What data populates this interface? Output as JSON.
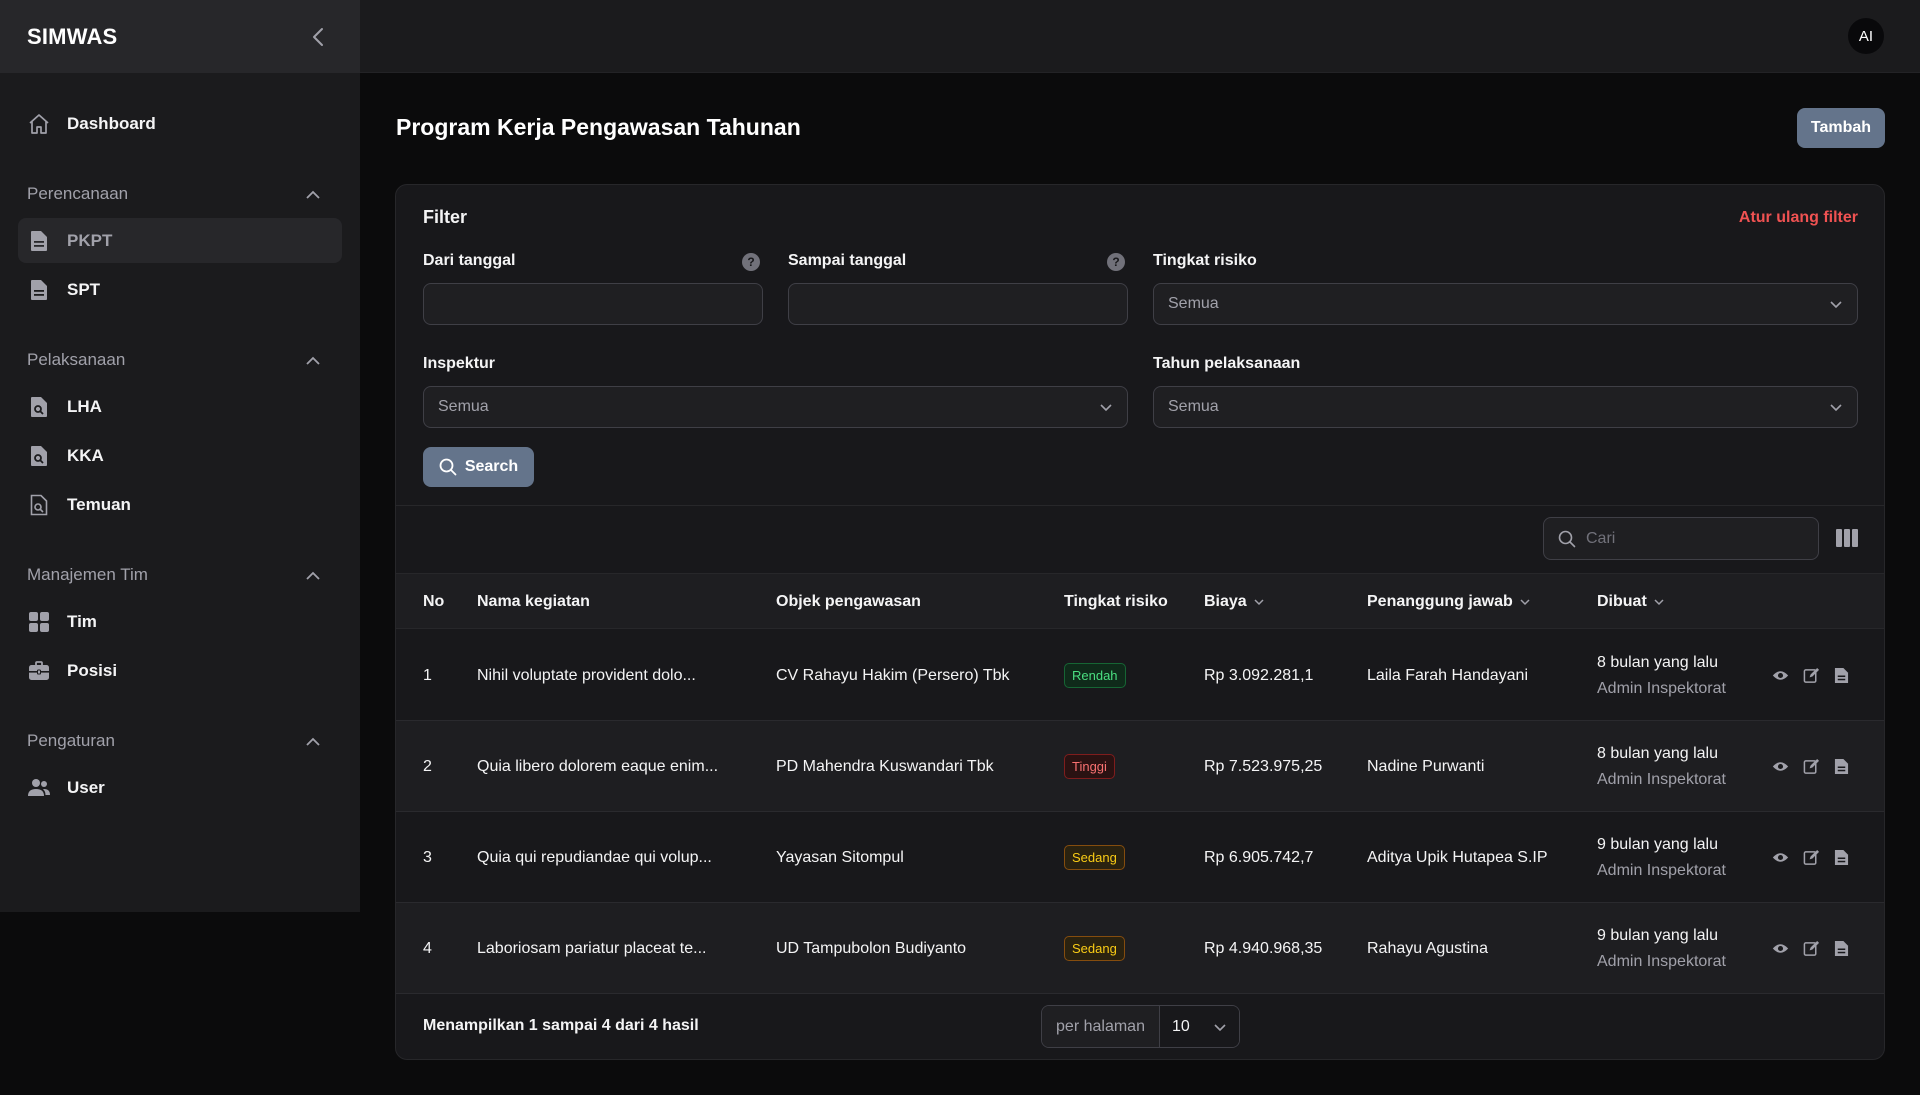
{
  "app": {
    "brand": "SIMWAS",
    "avatar_initials": "AI"
  },
  "sidebar": {
    "dashboard": "Dashboard",
    "groups": [
      {
        "title": "Perencanaan",
        "items": [
          {
            "label": "PKPT",
            "icon": "document-icon"
          },
          {
            "label": "SPT",
            "icon": "document-icon"
          }
        ]
      },
      {
        "title": "Pelaksanaan",
        "items": [
          {
            "label": "LHA",
            "icon": "document-search-icon"
          },
          {
            "label": "KKA",
            "icon": "document-search-icon"
          },
          {
            "label": "Temuan",
            "icon": "document-search-outline-icon"
          }
        ]
      },
      {
        "title": "Manajemen Tim",
        "items": [
          {
            "label": "Tim",
            "icon": "grid-icon"
          },
          {
            "label": "Posisi",
            "icon": "briefcase-icon"
          }
        ]
      },
      {
        "title": "Pengaturan",
        "items": [
          {
            "label": "User",
            "icon": "users-icon"
          }
        ]
      }
    ]
  },
  "page": {
    "title": "Program Kerja Pengawasan Tahunan",
    "add_label": "Tambah"
  },
  "filter": {
    "title": "Filter",
    "reset_label": "Atur ulang filter",
    "from_date_label": "Dari tanggal",
    "to_date_label": "Sampai tanggal",
    "risk_label": "Tingkat risiko",
    "risk_value": "Semua",
    "inspector_label": "Inspektur",
    "inspector_value": "Semua",
    "year_label": "Tahun pelaksanaan",
    "year_value": "Semua",
    "search_label": "Search"
  },
  "table": {
    "search_placeholder": "Cari",
    "headers": {
      "no": "No",
      "name": "Nama kegiatan",
      "object": "Objek pengawasan",
      "risk": "Tingkat risiko",
      "cost": "Biaya",
      "pic": "Penanggung jawab",
      "created": "Dibuat"
    },
    "rows": [
      {
        "no": "1",
        "name": "Nihil voluptate provident dolo...",
        "object": "CV Rahayu Hakim (Persero) Tbk",
        "risk": "Rendah",
        "risk_level": "low",
        "cost": "Rp 3.092.281,1",
        "pic": "Laila Farah Handayani",
        "created": "8 bulan yang lalu",
        "by": "Admin Inspektorat"
      },
      {
        "no": "2",
        "name": "Quia libero dolorem eaque enim...",
        "object": "PD Mahendra Kuswandari Tbk",
        "risk": "Tinggi",
        "risk_level": "high",
        "cost": "Rp 7.523.975,25",
        "pic": "Nadine Purwanti",
        "created": "8 bulan yang lalu",
        "by": "Admin Inspektorat"
      },
      {
        "no": "3",
        "name": "Quia qui repudiandae qui volup...",
        "object": "Yayasan Sitompul",
        "risk": "Sedang",
        "risk_level": "mid",
        "cost": "Rp 6.905.742,7",
        "pic": "Aditya Upik Hutapea S.IP",
        "created": "9 bulan yang lalu",
        "by": "Admin Inspektorat"
      },
      {
        "no": "4",
        "name": "Laboriosam pariatur placeat te...",
        "object": "UD Tampubolon Budiyanto",
        "risk": "Sedang",
        "risk_level": "mid",
        "cost": "Rp 4.940.968,35",
        "pic": "Rahayu Agustina",
        "created": "9 bulan yang lalu",
        "by": "Admin Inspektorat"
      }
    ],
    "summary": "Menampilkan 1 sampai 4 dari 4 hasil",
    "per_page_label": "per halaman",
    "per_page_value": "10"
  },
  "colors": {
    "accent": "#64748b",
    "danger": "#f05252",
    "bg": "#0b0b0c",
    "sidebar": "#1b1b1d"
  }
}
